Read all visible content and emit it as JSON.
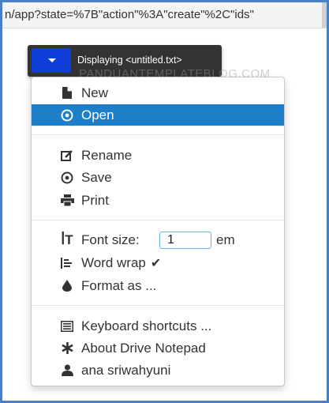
{
  "address_bar": {
    "url": "n/app?state=%7B\"action\"%3A\"create\"%2C\"ids\""
  },
  "toolbar": {
    "status": "Displaying <untitled.txt>"
  },
  "watermark": "PANDUANTEMPLATEBLOG.COM",
  "menu": {
    "new": "New",
    "open": "Open",
    "rename": "Rename",
    "save": "Save",
    "print": "Print",
    "font_size_label": "Font size:",
    "font_size_value": "1",
    "font_size_unit": "em",
    "word_wrap": "Word wrap",
    "word_wrap_checked": "✔",
    "format_as": "Format as ...",
    "keyboard_shortcuts": "Keyboard shortcuts ...",
    "about": "About Drive Notepad",
    "user": "ana sriwahyuni"
  },
  "colors": {
    "frame_border": "#4a7fc4",
    "toolbar_bg": "#333333",
    "menu_button_bg": "#0f3fd8",
    "active_item_bg": "#1e7fc8"
  }
}
